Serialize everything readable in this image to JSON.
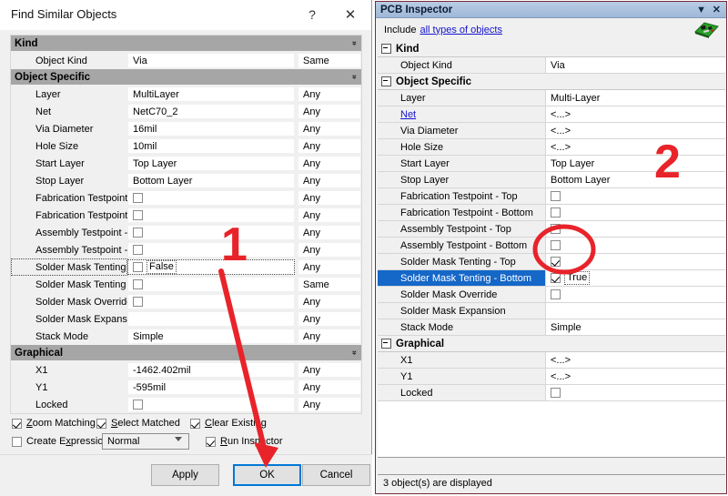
{
  "find_similar_dialog": {
    "title": "Find Similar Objects",
    "help_icon": "?",
    "close_icon": "✕",
    "groups": [
      {
        "name": "Kind",
        "collapse_icon": "chevron-double-down",
        "rows": [
          {
            "label": "Object Kind",
            "value": "Via",
            "match": "Same",
            "type": "text"
          }
        ]
      },
      {
        "name": "Object Specific",
        "collapse_icon": "chevron-double-down",
        "rows": [
          {
            "label": "Layer",
            "value": "MultiLayer",
            "match": "Any",
            "type": "text"
          },
          {
            "label": "Net",
            "value": "NetC70_2",
            "match": "Any",
            "type": "text"
          },
          {
            "label": "Via Diameter",
            "value": "16mil",
            "match": "Any",
            "type": "text"
          },
          {
            "label": "Hole Size",
            "value": "10mil",
            "match": "Any",
            "type": "text"
          },
          {
            "label": "Start Layer",
            "value": "Top Layer",
            "match": "Any",
            "type": "text"
          },
          {
            "label": "Stop Layer",
            "value": "Bottom Layer",
            "match": "Any",
            "type": "text"
          },
          {
            "label": "Fabrication Testpoint - T",
            "value": "",
            "match": "Any",
            "type": "checkbox",
            "checked": false
          },
          {
            "label": "Fabrication Testpoint - B",
            "value": "",
            "match": "Any",
            "type": "checkbox",
            "checked": false
          },
          {
            "label": "Assembly Testpoint - Top",
            "value": "",
            "match": "Any",
            "type": "checkbox",
            "checked": false
          },
          {
            "label": "Assembly Testpoint - Bot",
            "value": "",
            "match": "Any",
            "type": "checkbox",
            "checked": false
          },
          {
            "label": "Solder Mask Tenting - T",
            "value": "False",
            "match": "Any",
            "type": "checkbox",
            "checked": false,
            "focused": true
          },
          {
            "label": "Solder Mask Tenting - B",
            "value": "",
            "match": "Same",
            "type": "checkbox",
            "checked": false
          },
          {
            "label": "Solder Mask Override",
            "value": "",
            "match": "Any",
            "type": "checkbox",
            "checked": false
          },
          {
            "label": "Solder Mask Expansion",
            "value": "",
            "match": "Any",
            "type": "text"
          },
          {
            "label": "Stack Mode",
            "value": "Simple",
            "match": "Any",
            "type": "text"
          }
        ]
      },
      {
        "name": "Graphical",
        "collapse_icon": "chevron-double-down",
        "rows": [
          {
            "label": "X1",
            "value": "-1462.402mil",
            "match": "Any",
            "type": "text"
          },
          {
            "label": "Y1",
            "value": "-595mil",
            "match": "Any",
            "type": "text"
          },
          {
            "label": "Locked",
            "value": "",
            "match": "Any",
            "type": "checkbox",
            "checked": false
          }
        ]
      }
    ],
    "options": {
      "zoom_matching": {
        "label": "Zoom Matching",
        "accel": "Z",
        "checked": true
      },
      "select_matched": {
        "label": "Select Matched",
        "accel": "S",
        "checked": true
      },
      "clear_existing": {
        "label": "Clear Existing",
        "accel": "C",
        "checked": true
      },
      "create_expression": {
        "label": "Create Expression",
        "accel": "x",
        "checked": false
      },
      "mode_combo": {
        "value": "Normal"
      },
      "run_inspector": {
        "label": "Run Inspector",
        "accel": "R",
        "checked": true
      }
    },
    "buttons": {
      "apply": "Apply",
      "ok": "OK",
      "cancel": "Cancel"
    }
  },
  "pcb_inspector": {
    "title": "PCB Inspector",
    "collapse_icon": "▼",
    "close_icon": "✕",
    "include_label": "Include",
    "include_link": "all types of objects",
    "groups": [
      {
        "name": "Kind",
        "rows": [
          {
            "label": "Object Kind",
            "value": "Via",
            "type": "text"
          }
        ]
      },
      {
        "name": "Object Specific",
        "rows": [
          {
            "label": "Layer",
            "value": "Multi-Layer",
            "type": "text"
          },
          {
            "label": "Net",
            "value": "<...>",
            "type": "text",
            "link": true
          },
          {
            "label": "Via Diameter",
            "value": "<...>",
            "type": "text"
          },
          {
            "label": "Hole Size",
            "value": "<...>",
            "type": "text"
          },
          {
            "label": "Start Layer",
            "value": "Top Layer",
            "type": "text"
          },
          {
            "label": "Stop Layer",
            "value": "Bottom Layer",
            "type": "text"
          },
          {
            "label": "Fabrication Testpoint - Top",
            "value": "",
            "type": "checkbox",
            "checked": false
          },
          {
            "label": "Fabrication Testpoint - Bottom",
            "value": "",
            "type": "checkbox",
            "checked": false
          },
          {
            "label": "Assembly Testpoint - Top",
            "value": "",
            "type": "checkbox",
            "checked": false
          },
          {
            "label": "Assembly Testpoint - Bottom",
            "value": "",
            "type": "checkbox",
            "checked": false
          },
          {
            "label": "Solder Mask Tenting - Top",
            "value": "",
            "type": "checkbox",
            "checked": true
          },
          {
            "label": "Solder Mask Tenting - Bottom",
            "value": "True",
            "type": "checkbox",
            "checked": true,
            "selected": true
          },
          {
            "label": "Solder Mask Override",
            "value": "",
            "type": "checkbox",
            "checked": false
          },
          {
            "label": "Solder Mask Expansion",
            "value": "",
            "type": "text"
          },
          {
            "label": "Stack Mode",
            "value": "Simple",
            "type": "text"
          }
        ]
      },
      {
        "name": "Graphical",
        "rows": [
          {
            "label": "X1",
            "value": "<...>",
            "type": "text"
          },
          {
            "label": "Y1",
            "value": "<...>",
            "type": "text"
          },
          {
            "label": "Locked",
            "value": "",
            "type": "checkbox",
            "checked": false
          }
        ]
      }
    ],
    "status": "3 object(s) are displayed"
  },
  "annotations": {
    "step_one": "1",
    "step_two": "2",
    "color": "#e8232a",
    "arrow_name": "red-arrow-pointing-to-ok-button",
    "circle_name": "red-ellipse-highlighting-solder-mask-tenting-checkboxes"
  }
}
